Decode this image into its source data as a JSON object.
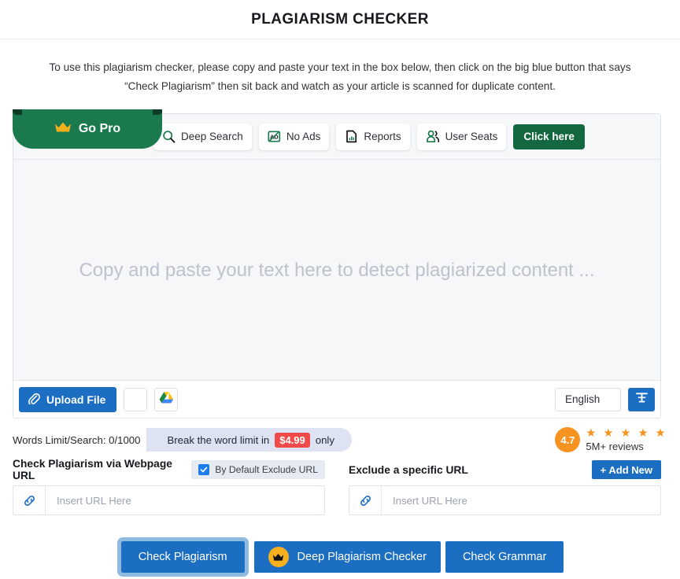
{
  "header": {
    "title": "PLAGIARISM CHECKER"
  },
  "intro": {
    "line1": "To use this plagiarism checker, please copy and paste your text in the box below, then click on the big blue button that says",
    "line2": "“Check Plagiarism” then sit back and watch as your article is scanned for duplicate content."
  },
  "pro_bar": {
    "ribbon_label": "Go Pro",
    "features": [
      {
        "label": "Deep Search",
        "icon": "search-icon"
      },
      {
        "label": "No Ads",
        "icon": "no-ads-icon"
      },
      {
        "label": "Reports",
        "icon": "report-icon"
      },
      {
        "label": "User Seats",
        "icon": "users-icon"
      }
    ],
    "cta_label": "Click here"
  },
  "editor": {
    "placeholder": "Copy and paste your text here to detect plagiarized content ...",
    "upload_label": "Upload File",
    "language": "English",
    "icons": {
      "paperclip": "paperclip-icon",
      "blank": "blank-doc-icon",
      "drive": "google-drive-icon",
      "format": "text-format-icon"
    }
  },
  "limits": {
    "words_label": "Words Limit/Search: 0/1000",
    "offer_prefix": "Break the word limit in",
    "offer_price": "$4.99",
    "offer_suffix": "only"
  },
  "rating": {
    "score": "4.7",
    "stars": "★ ★ ★ ★ ★",
    "reviews": "5M+ reviews"
  },
  "url_section": {
    "left_label": "Check Plagiarism via Webpage URL",
    "exclude_checkbox_label": "By Default Exclude URL",
    "left_placeholder": "Insert URL Here",
    "right_label": "Exclude a specific URL",
    "add_new_label": "+ Add New",
    "right_placeholder": "Insert URL Here"
  },
  "actions": {
    "check_plagiarism": "Check Plagiarism",
    "deep_checker": "Deep Plagiarism Checker",
    "check_grammar": "Check Grammar"
  },
  "colors": {
    "primary_blue": "#1b6ec2",
    "green": "#1a7a4e",
    "dark_green": "#13683f",
    "orange": "#f79421",
    "gold": "#f6b01e",
    "red": "#f04a4a"
  }
}
